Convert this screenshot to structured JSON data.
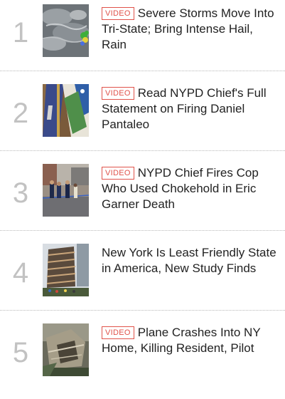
{
  "badge_color": "#e0524a",
  "rank_color": "#c2c2c2",
  "items": [
    {
      "rank": "1",
      "badge": "VIDEO",
      "title": "Severe Storms Move Into Tri-State; Bring Intense Hail, Rain",
      "thumb_icon": "weather-radar-thumbnail"
    },
    {
      "rank": "2",
      "badge": "VIDEO",
      "title": "Read NYPD Chief's Full Statement on Firing Daniel Pantaleo",
      "thumb_icon": "flags-thumbnail"
    },
    {
      "rank": "3",
      "badge": "VIDEO",
      "title": "NYPD Chief Fires Cop Who Used Chokehold in Eric Garner Death",
      "thumb_icon": "police-street-thumbnail"
    },
    {
      "rank": "4",
      "badge": "",
      "title": "New York Is Least Friendly State in America, New Study Finds",
      "thumb_icon": "vessel-building-thumbnail"
    },
    {
      "rank": "5",
      "badge": "VIDEO",
      "title": "Plane Crashes Into NY Home, Killing Resident, Pilot",
      "thumb_icon": "damaged-house-thumbnail"
    }
  ]
}
